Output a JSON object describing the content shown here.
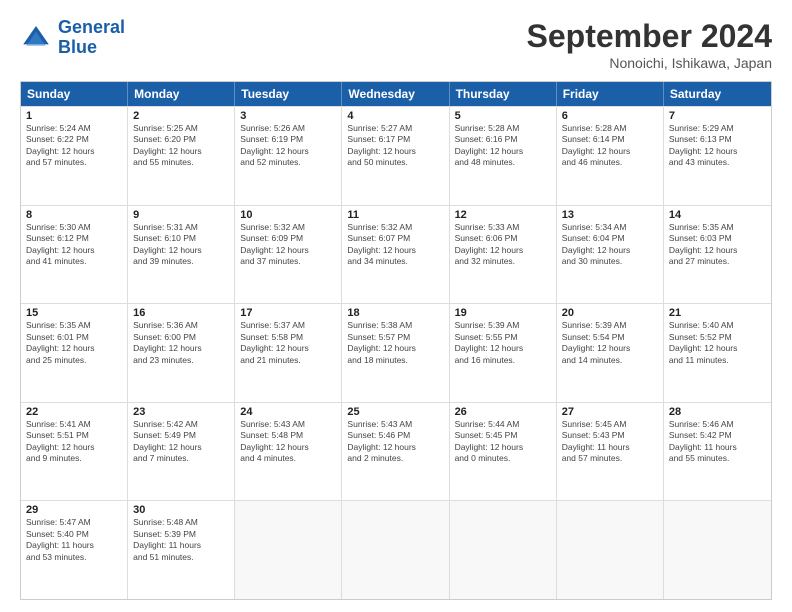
{
  "logo": {
    "line1": "General",
    "line2": "Blue"
  },
  "title": "September 2024",
  "subtitle": "Nonoichi, Ishikawa, Japan",
  "weekdays": [
    "Sunday",
    "Monday",
    "Tuesday",
    "Wednesday",
    "Thursday",
    "Friday",
    "Saturday"
  ],
  "weeks": [
    [
      {
        "day": "1",
        "info": "Sunrise: 5:24 AM\nSunset: 6:22 PM\nDaylight: 12 hours\nand 57 minutes."
      },
      {
        "day": "2",
        "info": "Sunrise: 5:25 AM\nSunset: 6:20 PM\nDaylight: 12 hours\nand 55 minutes."
      },
      {
        "day": "3",
        "info": "Sunrise: 5:26 AM\nSunset: 6:19 PM\nDaylight: 12 hours\nand 52 minutes."
      },
      {
        "day": "4",
        "info": "Sunrise: 5:27 AM\nSunset: 6:17 PM\nDaylight: 12 hours\nand 50 minutes."
      },
      {
        "day": "5",
        "info": "Sunrise: 5:28 AM\nSunset: 6:16 PM\nDaylight: 12 hours\nand 48 minutes."
      },
      {
        "day": "6",
        "info": "Sunrise: 5:28 AM\nSunset: 6:14 PM\nDaylight: 12 hours\nand 46 minutes."
      },
      {
        "day": "7",
        "info": "Sunrise: 5:29 AM\nSunset: 6:13 PM\nDaylight: 12 hours\nand 43 minutes."
      }
    ],
    [
      {
        "day": "8",
        "info": "Sunrise: 5:30 AM\nSunset: 6:12 PM\nDaylight: 12 hours\nand 41 minutes."
      },
      {
        "day": "9",
        "info": "Sunrise: 5:31 AM\nSunset: 6:10 PM\nDaylight: 12 hours\nand 39 minutes."
      },
      {
        "day": "10",
        "info": "Sunrise: 5:32 AM\nSunset: 6:09 PM\nDaylight: 12 hours\nand 37 minutes."
      },
      {
        "day": "11",
        "info": "Sunrise: 5:32 AM\nSunset: 6:07 PM\nDaylight: 12 hours\nand 34 minutes."
      },
      {
        "day": "12",
        "info": "Sunrise: 5:33 AM\nSunset: 6:06 PM\nDaylight: 12 hours\nand 32 minutes."
      },
      {
        "day": "13",
        "info": "Sunrise: 5:34 AM\nSunset: 6:04 PM\nDaylight: 12 hours\nand 30 minutes."
      },
      {
        "day": "14",
        "info": "Sunrise: 5:35 AM\nSunset: 6:03 PM\nDaylight: 12 hours\nand 27 minutes."
      }
    ],
    [
      {
        "day": "15",
        "info": "Sunrise: 5:35 AM\nSunset: 6:01 PM\nDaylight: 12 hours\nand 25 minutes."
      },
      {
        "day": "16",
        "info": "Sunrise: 5:36 AM\nSunset: 6:00 PM\nDaylight: 12 hours\nand 23 minutes."
      },
      {
        "day": "17",
        "info": "Sunrise: 5:37 AM\nSunset: 5:58 PM\nDaylight: 12 hours\nand 21 minutes."
      },
      {
        "day": "18",
        "info": "Sunrise: 5:38 AM\nSunset: 5:57 PM\nDaylight: 12 hours\nand 18 minutes."
      },
      {
        "day": "19",
        "info": "Sunrise: 5:39 AM\nSunset: 5:55 PM\nDaylight: 12 hours\nand 16 minutes."
      },
      {
        "day": "20",
        "info": "Sunrise: 5:39 AM\nSunset: 5:54 PM\nDaylight: 12 hours\nand 14 minutes."
      },
      {
        "day": "21",
        "info": "Sunrise: 5:40 AM\nSunset: 5:52 PM\nDaylight: 12 hours\nand 11 minutes."
      }
    ],
    [
      {
        "day": "22",
        "info": "Sunrise: 5:41 AM\nSunset: 5:51 PM\nDaylight: 12 hours\nand 9 minutes."
      },
      {
        "day": "23",
        "info": "Sunrise: 5:42 AM\nSunset: 5:49 PM\nDaylight: 12 hours\nand 7 minutes."
      },
      {
        "day": "24",
        "info": "Sunrise: 5:43 AM\nSunset: 5:48 PM\nDaylight: 12 hours\nand 4 minutes."
      },
      {
        "day": "25",
        "info": "Sunrise: 5:43 AM\nSunset: 5:46 PM\nDaylight: 12 hours\nand 2 minutes."
      },
      {
        "day": "26",
        "info": "Sunrise: 5:44 AM\nSunset: 5:45 PM\nDaylight: 12 hours\nand 0 minutes."
      },
      {
        "day": "27",
        "info": "Sunrise: 5:45 AM\nSunset: 5:43 PM\nDaylight: 11 hours\nand 57 minutes."
      },
      {
        "day": "28",
        "info": "Sunrise: 5:46 AM\nSunset: 5:42 PM\nDaylight: 11 hours\nand 55 minutes."
      }
    ],
    [
      {
        "day": "29",
        "info": "Sunrise: 5:47 AM\nSunset: 5:40 PM\nDaylight: 11 hours\nand 53 minutes."
      },
      {
        "day": "30",
        "info": "Sunrise: 5:48 AM\nSunset: 5:39 PM\nDaylight: 11 hours\nand 51 minutes."
      },
      {
        "day": "",
        "info": ""
      },
      {
        "day": "",
        "info": ""
      },
      {
        "day": "",
        "info": ""
      },
      {
        "day": "",
        "info": ""
      },
      {
        "day": "",
        "info": ""
      }
    ]
  ]
}
